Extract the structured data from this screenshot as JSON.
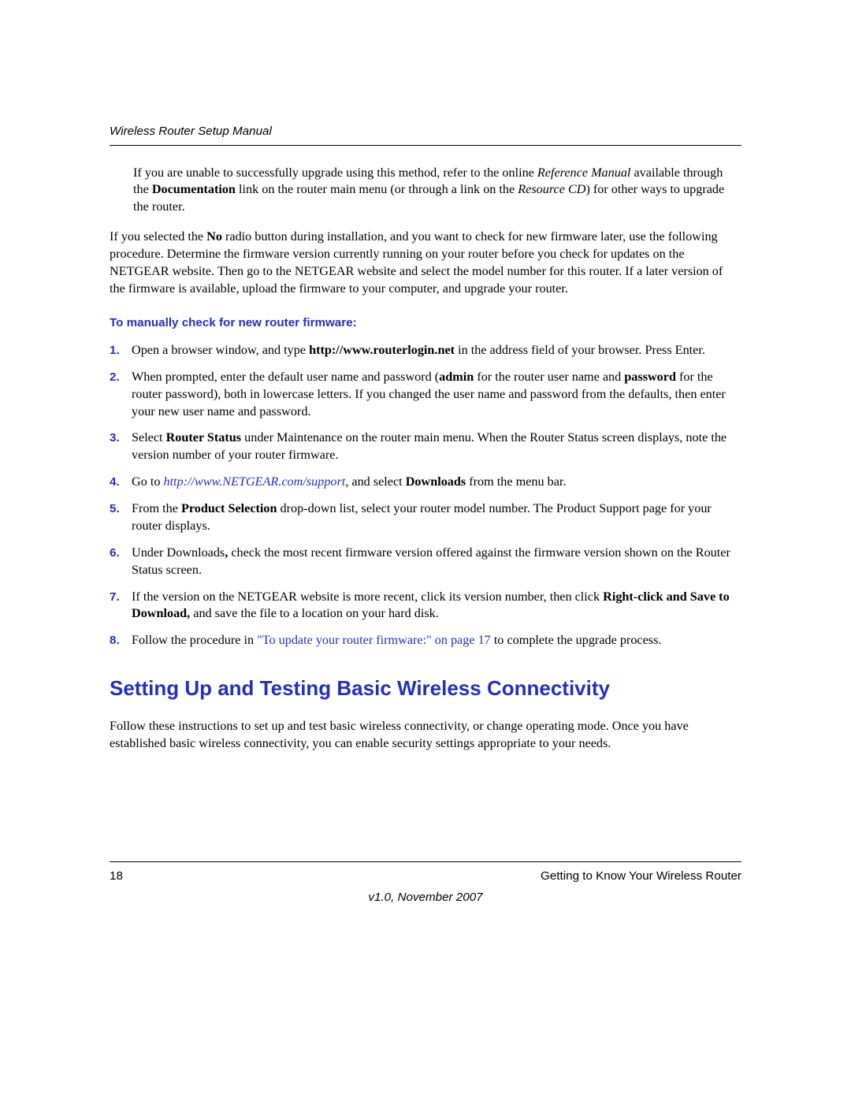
{
  "header": {
    "title": "Wireless Router Setup Manual"
  },
  "intro_block": {
    "pre": "If you are unable to successfully upgrade using this method, refer to the online ",
    "ref1": "Reference Manual",
    "mid1": " available through the ",
    "bold1": "Documentation",
    "mid2": " link on the router main menu (or through a link on the ",
    "ref2": "Resource CD",
    "post": ") for other ways to upgrade the router."
  },
  "para2": {
    "pre": "If you selected the ",
    "bold": "No",
    "post": " radio button during installation, and you want to check for new firmware later, use the following procedure. Determine the firmware version currently running on your router before you check for updates on the NETGEAR website. Then go to the NETGEAR website and select the model number for this router. If a later version of the firmware is available, upload the firmware to your computer, and upgrade your router."
  },
  "subheading": "To manually check for new router firmware:",
  "steps": [
    {
      "num": "1.",
      "t1": "Open a browser window, and type ",
      "b1": "http://www.routerlogin.net",
      "t2": " in the address field of your browser. Press Enter."
    },
    {
      "num": "2.",
      "t1": "When prompted, enter the default user name and password (",
      "b1": "admin ",
      "t2": " for the router user name and ",
      "b2": "password",
      "t3": " for the router password), both in lowercase letters. If you changed the user name and password from the defaults, then enter your new user name and password."
    },
    {
      "num": "3.",
      "t1": "Select ",
      "b1": "Router Status",
      "t2": " under Maintenance on the router main menu. When the Router Status screen displays, note the version number of your router firmware."
    },
    {
      "num": "4.",
      "t1": "Go to ",
      "link": "http://www.NETGEAR.com/support",
      "t2": ", and select ",
      "b1": "Downloads",
      "t3": " from the menu bar."
    },
    {
      "num": "5.",
      "t1": "From the ",
      "b1": "Product Selection",
      "t2": " drop-down list, select your router model number. The Product Support page for your router displays."
    },
    {
      "num": "6.",
      "t1": "Under Downloads",
      "b1": ",",
      "t2": " check the most recent firmware version offered against the firmware version shown on the Router Status screen."
    },
    {
      "num": "7.",
      "t1": "If the version on the NETGEAR website is more recent, click its version number, then click ",
      "b1": "Right-click and Save to Download,",
      "t2": " and save the file to a location on your hard disk."
    },
    {
      "num": "8.",
      "t1": "Follow the procedure in ",
      "link": "\"To update your router firmware:\" on page 17",
      "t2": " to complete the upgrade process."
    }
  ],
  "h1": "Setting Up and Testing Basic Wireless Connectivity",
  "para3": "Follow these instructions to set up and test basic wireless connectivity, or change operating mode. Once you have established basic wireless connectivity, you can enable security settings appropriate to your needs.",
  "footer": {
    "page": "18",
    "section": "Getting to Know Your Wireless Router",
    "version": "v1.0, November 2007"
  }
}
